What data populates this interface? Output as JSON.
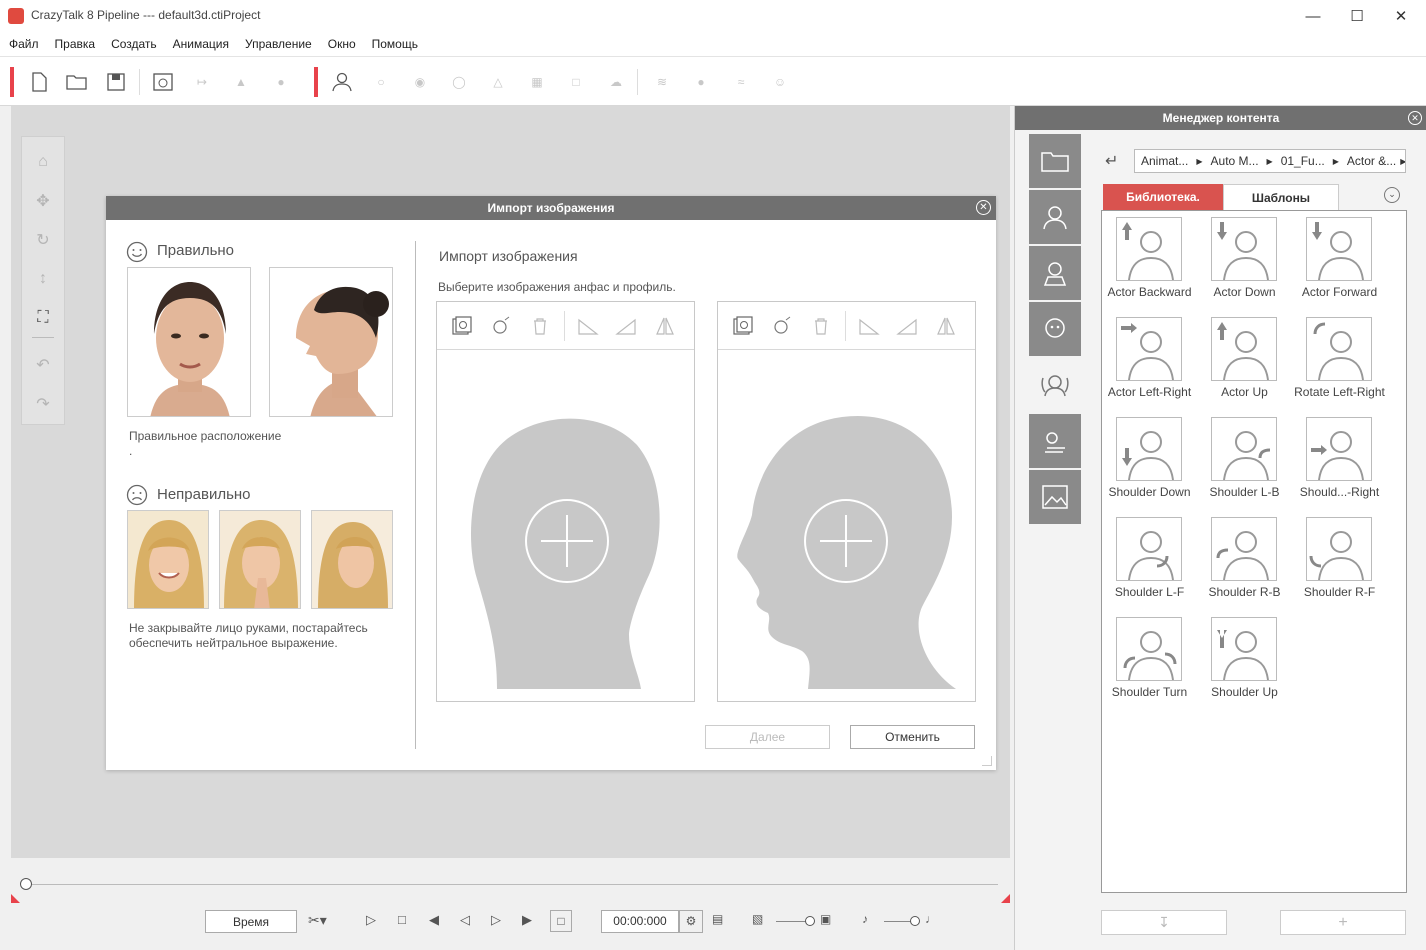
{
  "window": {
    "title": "CrazyTalk 8 Pipeline --- default3d.ctiProject"
  },
  "menu": [
    "Файл",
    "Правка",
    "Создать",
    "Анимация",
    "Управление",
    "Окно",
    "Помощь"
  ],
  "dialog": {
    "title": "Импорт изображения",
    "correct_heading": "Правильно",
    "correct_note": "Правильное расположение",
    "correct_note_dot": ".",
    "wrong_heading": "Неправильно",
    "wrong_note": "Не закрывайте лицо руками, постарайтесь обеспечить нейтральное выражение.",
    "import_heading": "Импорт изображения",
    "import_subtitle": "Выберите изображения анфас и профиль.",
    "next_button": "Далее",
    "cancel_button": "Отменить"
  },
  "timeline": {
    "mode_button": "Время",
    "time": "00:00:000"
  },
  "content_manager": {
    "title": "Менеджер контента",
    "breadcrumb": [
      "Animat...",
      "Auto M...",
      "01_Fu...",
      "Actor &..."
    ],
    "tabs": [
      "Библиотека.",
      "Шаблоны"
    ],
    "items": [
      "Actor Backward",
      "Actor Down",
      "Actor Forward",
      "Actor Left-Right",
      "Actor Up",
      "Rotate Left-Right",
      "Shoulder Down",
      "Shoulder L-B",
      "Should...-Right",
      "Shoulder L-F",
      "Shoulder R-B",
      "Shoulder R-F",
      "Shoulder Turn",
      "Shoulder Up"
    ]
  },
  "colors": {
    "accent_red": "#e8424b",
    "header_gray": "#707070",
    "active_tab": "#d9534f"
  },
  "icons": [
    "new-file-icon",
    "open-folder-icon",
    "save-icon",
    "import-image-icon",
    "person-icon",
    "eye-icon",
    "mouth-icon",
    "play-icon",
    "stop-icon",
    "settings-icon",
    "folder-icon",
    "plus-icon",
    "download-icon"
  ]
}
